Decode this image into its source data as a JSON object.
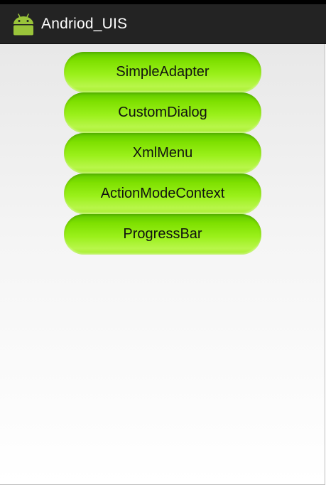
{
  "app": {
    "title": "Andriod_UIS",
    "icon": "android-robot-icon",
    "icon_color": "#9ac43a"
  },
  "buttons": [
    {
      "label": "SimpleAdapter"
    },
    {
      "label": "CustomDialog"
    },
    {
      "label": "XmlMenu"
    },
    {
      "label": "ActionModeContext"
    },
    {
      "label": "ProgressBar"
    }
  ],
  "colors": {
    "action_bar": "#232323",
    "button_green": "#8ae80a"
  }
}
